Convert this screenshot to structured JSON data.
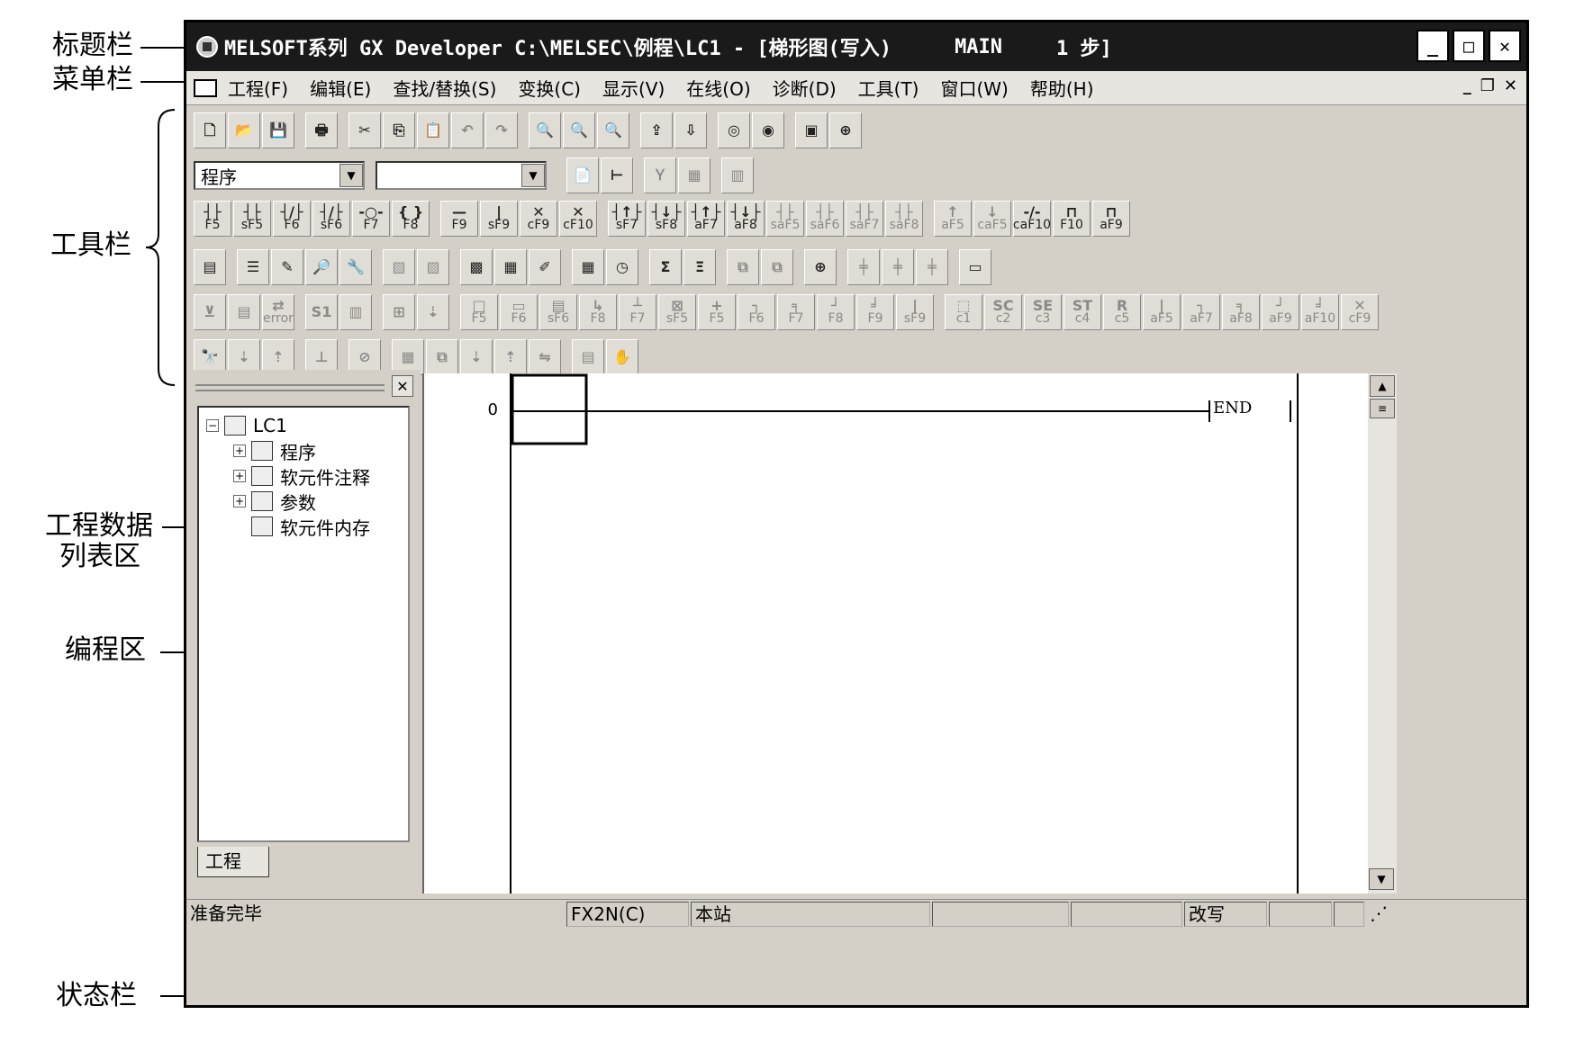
{
  "annotations": {
    "title_bar": "标题栏",
    "menu_bar": "菜单栏",
    "toolbar": "工具栏",
    "project_list_line1": "工程数据",
    "project_list_line2": "列表区",
    "programming_area": "编程区",
    "status_bar": "状态栏"
  },
  "titlebar": {
    "title": "MELSOFT系列 GX Developer C:\\MELSEC\\例程\\LC1 - [梯形图(写入)",
    "mode": "MAIN",
    "steps": "1 步]"
  },
  "menu": {
    "items": [
      "工程(F)",
      "编辑(E)",
      "查找/替换(S)",
      "变换(C)",
      "显示(V)",
      "在线(O)",
      "诊断(D)",
      "工具(T)",
      "窗口(W)",
      "帮助(H)"
    ]
  },
  "toolbar": {
    "program_combo": "程序",
    "ladder_keys": [
      "F5",
      "sF5",
      "F6",
      "sF6",
      "F7",
      "F8",
      "F9",
      "sF9",
      "cF9",
      "cF10",
      "sF7",
      "sF8",
      "aF7",
      "aF8",
      "saF5",
      "saF6",
      "saF7",
      "saF8",
      "aF5",
      "caF5",
      "caF10",
      "F10",
      "aF9"
    ],
    "sfc_keys": [
      "F5",
      "F6",
      "sF6",
      "F8",
      "F7",
      "sF5",
      "F5",
      "F6",
      "F7",
      "F8",
      "F9",
      "sF9",
      "c1",
      "c2",
      "c3",
      "c4",
      "c5",
      "aF5",
      "aF7",
      "aF8",
      "aF9",
      "aF10",
      "cF9"
    ],
    "error_label": "error"
  },
  "project_tree": {
    "root": "LC1",
    "children": [
      "程序",
      "软元件注释",
      "参数",
      "软元件内存"
    ],
    "tab": "工程"
  },
  "ladder": {
    "step_number": "0",
    "end_instruction": "END"
  },
  "statusbar": {
    "ready": "准备完毕",
    "plc": "FX2N(C)",
    "station": "本站",
    "mode": "改写"
  }
}
